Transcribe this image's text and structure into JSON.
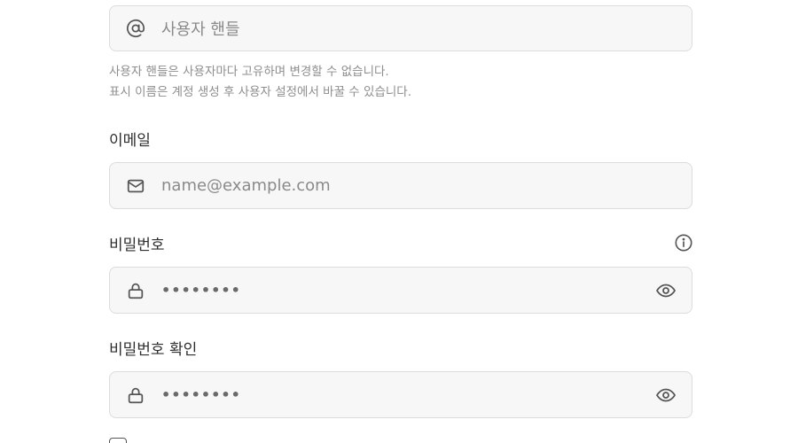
{
  "handle": {
    "placeholder": "사용자 핸들",
    "icon": "at-sign-icon",
    "help_line1": "사용자 핸들은 사용자마다 고유하며 변경할 수 없습니다.",
    "help_line2": "표시 이름은 계정 생성 후 사용자 설정에서 바꿀 수 있습니다."
  },
  "email": {
    "label": "이메일",
    "placeholder": "name@example.com",
    "icon": "mail-icon"
  },
  "password": {
    "label": "비밀번호",
    "value_masked": "••••••••",
    "icon": "lock-icon",
    "info_icon": "info-icon",
    "toggle_icon": "eye-icon"
  },
  "password_confirm": {
    "label": "비밀번호 확인",
    "value_masked": "••••••••",
    "icon": "lock-icon",
    "toggle_icon": "eye-icon"
  }
}
